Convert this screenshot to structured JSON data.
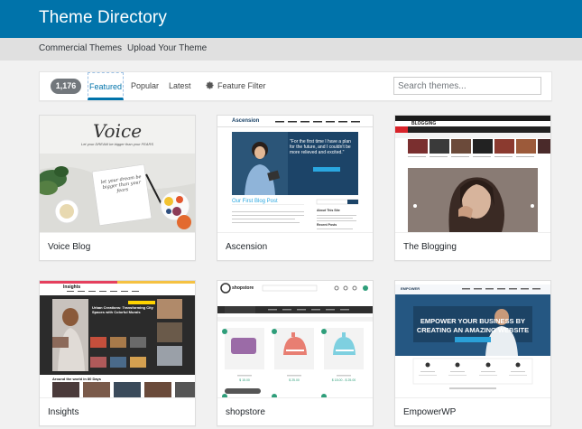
{
  "header": {
    "title": "Theme Directory"
  },
  "subnav": {
    "items": [
      {
        "label": "Commercial Themes"
      },
      {
        "label": "Upload Your Theme"
      }
    ]
  },
  "filter": {
    "count": "1,176",
    "tabs": [
      {
        "label": "Featured",
        "active": true
      },
      {
        "label": "Popular"
      },
      {
        "label": "Latest"
      }
    ],
    "feature_filter": "Feature Filter",
    "search_placeholder": "Search themes..."
  },
  "themes": [
    {
      "name": "Voice Blog",
      "preview": {
        "logo": "Voice",
        "tagline": "Let your DREAM be bigger than your FEARS",
        "notebook_text": "let your dream be bigger than your fears"
      }
    },
    {
      "name": "Ascension",
      "preview": {
        "logo": "Ascension",
        "hero_quote": "\"For the first time I have a plan for the future, and I couldn't be more relieved and excited.\"",
        "post_title": "Our First Blog Post",
        "sidebar_title": "About This Site",
        "sidebar_subtitle": "Recent Posts"
      }
    },
    {
      "name": "The Blogging",
      "preview": {
        "logo": "BLOGGING"
      }
    },
    {
      "name": "Insights",
      "preview": {
        "logo": "Insights",
        "headline": "Urban Creations: Transforming City Spaces with Colorful Murals",
        "footer_heading": "Around the world in 80 Days"
      }
    },
    {
      "name": "shopstore",
      "preview": {
        "logo": "shopstore",
        "product_price_1": "$ 15.00",
        "product_price_2": "$ 25.00",
        "product_price_3": "$ 18.00 - $ 25.00"
      }
    },
    {
      "name": "EmpowerWP",
      "preview": {
        "logo": "EMPOWER",
        "hero_line1": "EMPOWER YOUR BUSINESS BY",
        "hero_line2": "CREATING AN AMAZING WEBSITE"
      }
    }
  ],
  "colors": {
    "header_bg": "#0073aa",
    "subnav_bg": "#e0e0e0",
    "page_bg": "#f1f1f1",
    "count_badge": "#72777c",
    "accent": "#0073aa"
  }
}
